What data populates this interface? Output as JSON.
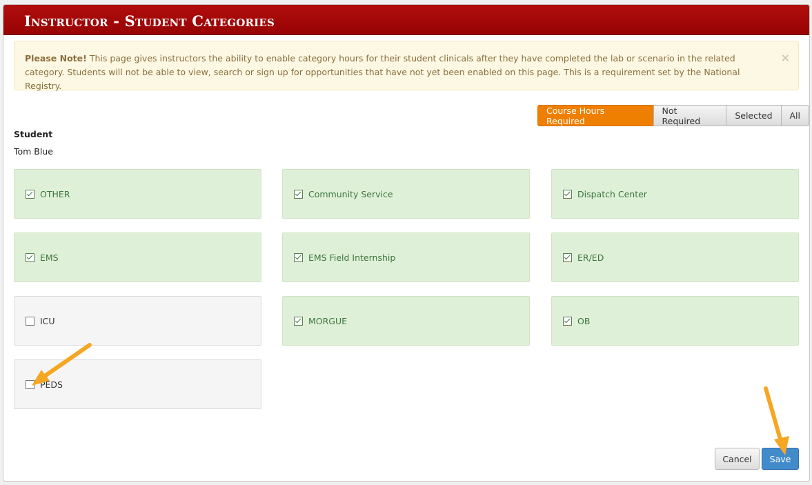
{
  "header": {
    "title": "Instructor - Student Categories"
  },
  "alert": {
    "strong": "Please Note!",
    "text": " This page gives instructors the ability to enable category hours for their student clinicals after they have completed the lab or scenario in the related category. Students will not be able to view, search or sign up for opportunities that have not yet been enabled on this page. This is a requirement set by the National Registry.",
    "close": "×"
  },
  "filters": {
    "course_hours_required": "Course Hours Required",
    "not_required": "Not Required",
    "selected": "Selected",
    "all": "All",
    "active": "Course Hours Required"
  },
  "student": {
    "label": "Student",
    "name": "Tom Blue"
  },
  "categories": [
    {
      "label": "OTHER",
      "checked": true
    },
    {
      "label": "Community Service",
      "checked": true
    },
    {
      "label": "Dispatch Center",
      "checked": true
    },
    {
      "label": "EMS",
      "checked": true
    },
    {
      "label": "EMS Field Internship",
      "checked": true
    },
    {
      "label": "ER/ED",
      "checked": true
    },
    {
      "label": "ICU",
      "checked": false
    },
    {
      "label": "MORGUE",
      "checked": true
    },
    {
      "label": "OB",
      "checked": true
    },
    {
      "label": "PEDS",
      "checked": false
    }
  ],
  "footer": {
    "cancel": "Cancel",
    "save": "Save"
  },
  "colors": {
    "header_red": "#a50808",
    "active_orange": "#ee7f00",
    "checked_green_bg": "#dff0d8",
    "unchecked_bg": "#f5f5f5",
    "save_blue": "#428bca",
    "annotation_arrow": "#f5a623"
  }
}
